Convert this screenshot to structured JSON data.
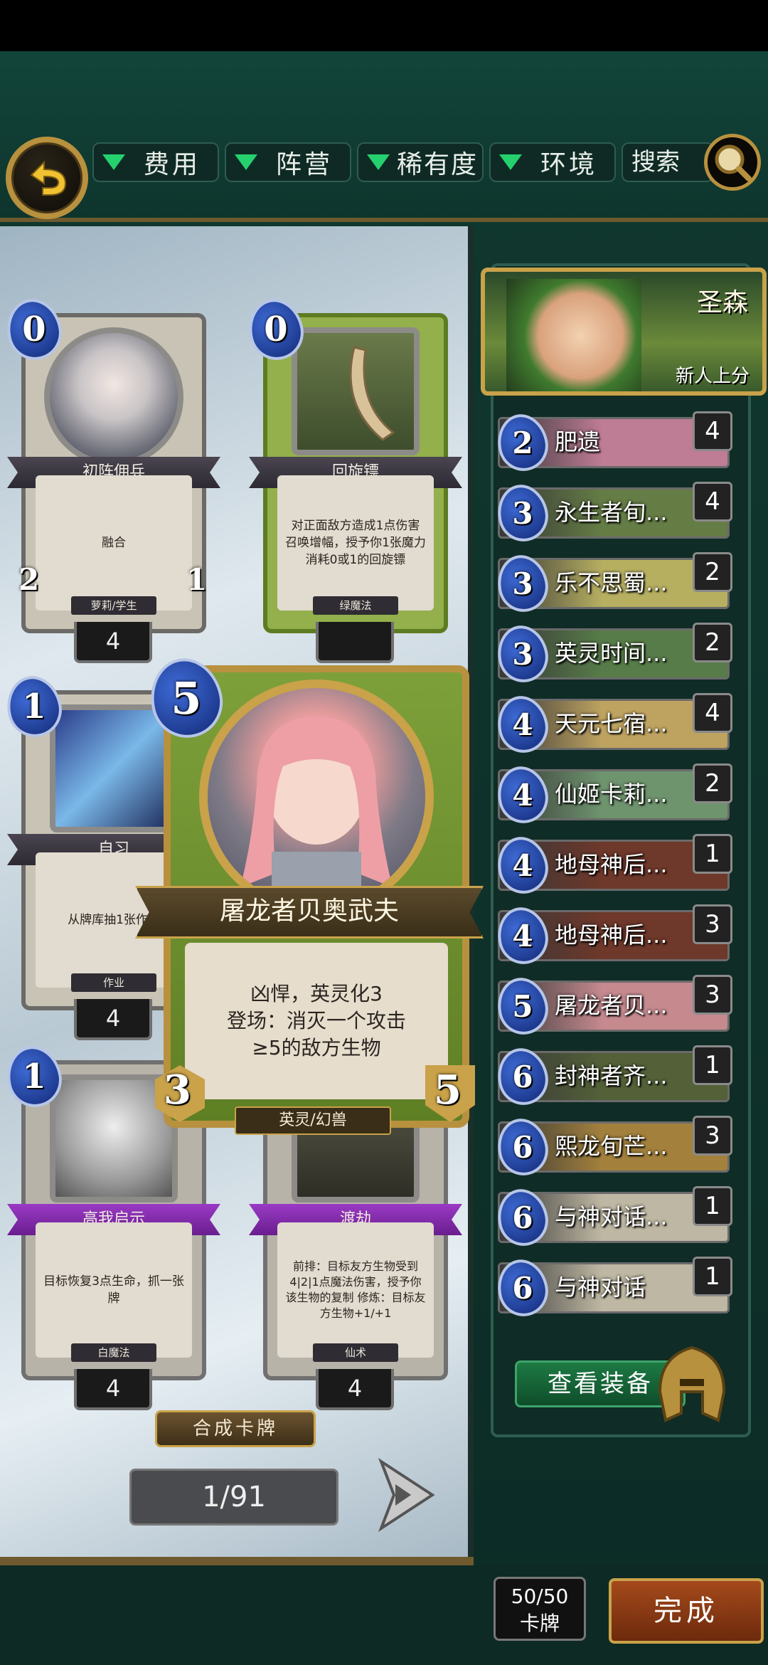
{
  "filters": {
    "cost_label": "费用",
    "faction_label": "阵营",
    "rarity_label": "稀有度",
    "environment_label": "环境",
    "search_label": "搜索"
  },
  "collection": {
    "cards": [
      {
        "cost": "0",
        "name": "初阵佣兵",
        "text": "融合",
        "tag": "萝莉/学生",
        "atk": "2",
        "hp": "1",
        "count": "4"
      },
      {
        "cost": "0",
        "name": "回旋镖",
        "text": "对正面敌方造成1点伤害 召唤增幅，授予你1张魔力消耗0或1的回旋镖",
        "tag": "绿魔法",
        "count": ""
      },
      {
        "cost": "1",
        "name": "自习",
        "text": "从牌库抽1张作业",
        "tag": "作业",
        "count": "4"
      },
      {
        "cost": "1",
        "name": "高我启示",
        "text": "目标恢复3点生命，抓一张牌",
        "tag": "白魔法",
        "count": "4"
      },
      {
        "cost": "",
        "name": "渡劫",
        "text": "前排：目标友方生物受到4|2|1点魔法伤害，授予你该生物的复制 修炼：目标友方生物+1/+1",
        "tag": "仙术",
        "count": "4"
      }
    ],
    "featured": {
      "cost": "5",
      "name": "屠龙者贝奥武夫",
      "text_line1": "凶悍，英灵化3",
      "text_line2": "登场：消灭一个攻击",
      "text_line3": "≥5的敌方生物",
      "tag": "英灵/幻兽",
      "atk": "3",
      "hp": "5"
    },
    "craft_label": "合成卡牌",
    "page": "1/91"
  },
  "deck": {
    "leader_name": "圣森",
    "format": "新人上分",
    "rows": [
      {
        "cost": "2",
        "name": "肥遗",
        "count": "4",
        "color": "#d98aa8"
      },
      {
        "cost": "3",
        "name": "永生者旬...",
        "count": "4",
        "color": "#6f8b4a"
      },
      {
        "cost": "3",
        "name": "乐不思蜀...",
        "count": "2",
        "color": "#cfc66a"
      },
      {
        "cost": "3",
        "name": "英灵时间...",
        "count": "2",
        "color": "#5f8a4e"
      },
      {
        "cost": "4",
        "name": "天元七宿...",
        "count": "4",
        "color": "#d8b86a"
      },
      {
        "cost": "4",
        "name": "仙姬卡莉...",
        "count": "2",
        "color": "#7aa67a"
      },
      {
        "cost": "4",
        "name": "地母神后...",
        "count": "1",
        "color": "#7a3a2a"
      },
      {
        "cost": "4",
        "name": "地母神后...",
        "count": "3",
        "color": "#7a3a2a"
      },
      {
        "cost": "5",
        "name": "屠龙者贝...",
        "count": "3",
        "color": "#e09aa0"
      },
      {
        "cost": "6",
        "name": "封神者齐...",
        "count": "1",
        "color": "#5a6a3a"
      },
      {
        "cost": "6",
        "name": "熙龙旬芒...",
        "count": "3",
        "color": "#b89040"
      },
      {
        "cost": "6",
        "name": "与神对话...",
        "count": "1",
        "color": "#d8d0b8"
      },
      {
        "cost": "6",
        "name": "与神对话",
        "count": "1",
        "color": "#d8d0b8"
      }
    ],
    "equip_label": "查看装备",
    "deck_count": "50/50",
    "deck_count_label": "卡牌",
    "done_label": "完成"
  }
}
